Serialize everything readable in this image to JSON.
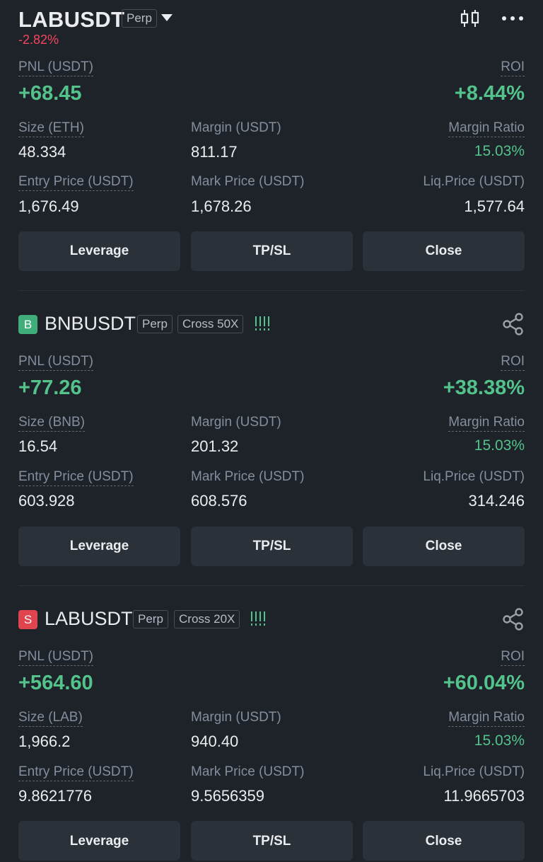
{
  "header": {
    "symbol": "LABUSDT",
    "type_tag": "Perp",
    "change": "-2.82%"
  },
  "first": {
    "pnl_label": "PNL (USDT)",
    "pnl": "+68.45",
    "roi_label": "ROI",
    "roi": "+8.44%",
    "size_label": "Size (ETH)",
    "size": "48.334",
    "margin_label": "Margin (USDT)",
    "margin": "811.17",
    "ratio_label": "Margin Ratio",
    "ratio": "15.03%",
    "entry_label": "Entry Price (USDT)",
    "entry": "1,676.49",
    "mark_label": "Mark Price (USDT)",
    "mark": "1,678.26",
    "liq_label": "Liq.Price (USDT)",
    "liq": "1,577.64",
    "btn_leverage": "Leverage",
    "btn_tpsl": "TP/SL",
    "btn_close": "Close"
  },
  "second": {
    "side": "B",
    "symbol": "BNBUSDT",
    "type_tag": "Perp",
    "margin_tag": "Cross 50X",
    "pnl_label": "PNL (USDT)",
    "pnl": "+77.26",
    "roi_label": "ROI",
    "roi": "+38.38%",
    "size_label": "Size (BNB)",
    "size": "16.54",
    "margin_label": "Margin (USDT)",
    "margin": "201.32",
    "ratio_label": "Margin Ratio",
    "ratio": "15.03%",
    "entry_label": "Entry Price (USDT)",
    "entry": "603.928",
    "mark_label": "Mark Price (USDT)",
    "mark": "608.576",
    "liq_label": "Liq.Price (USDT)",
    "liq": "314.246",
    "btn_leverage": "Leverage",
    "btn_tpsl": "TP/SL",
    "btn_close": "Close"
  },
  "third": {
    "side": "S",
    "symbol": "LABUSDT",
    "type_tag": "Perp",
    "margin_tag": "Cross 20X",
    "pnl_label": "PNL (USDT)",
    "pnl": "+564.60",
    "roi_label": "ROI",
    "roi": "+60.04%",
    "size_label": "Size (LAB)",
    "size": "1,966.2",
    "margin_label": "Margin (USDT)",
    "margin": "940.40",
    "ratio_label": "Margin Ratio",
    "ratio": "15.03%",
    "entry_label": "Entry Price (USDT)",
    "entry": "9.8621776",
    "mark_label": "Mark Price (USDT)",
    "mark": "9.5656359",
    "liq_label": "Liq.Price (USDT)",
    "liq": "11.9665703",
    "btn_leverage": "Leverage",
    "btn_tpsl": "TP/SL",
    "btn_close": "Close"
  },
  "icons": {
    "chart": "candlestick-icon",
    "more": "more-icon",
    "share": "share-icon",
    "risk": "risk-bars-icon",
    "dropdown": "caret-down-icon"
  },
  "colors": {
    "background": "#1e2229",
    "positive": "#53c28b",
    "negative": "#f6465d",
    "button": "#2b3139"
  }
}
